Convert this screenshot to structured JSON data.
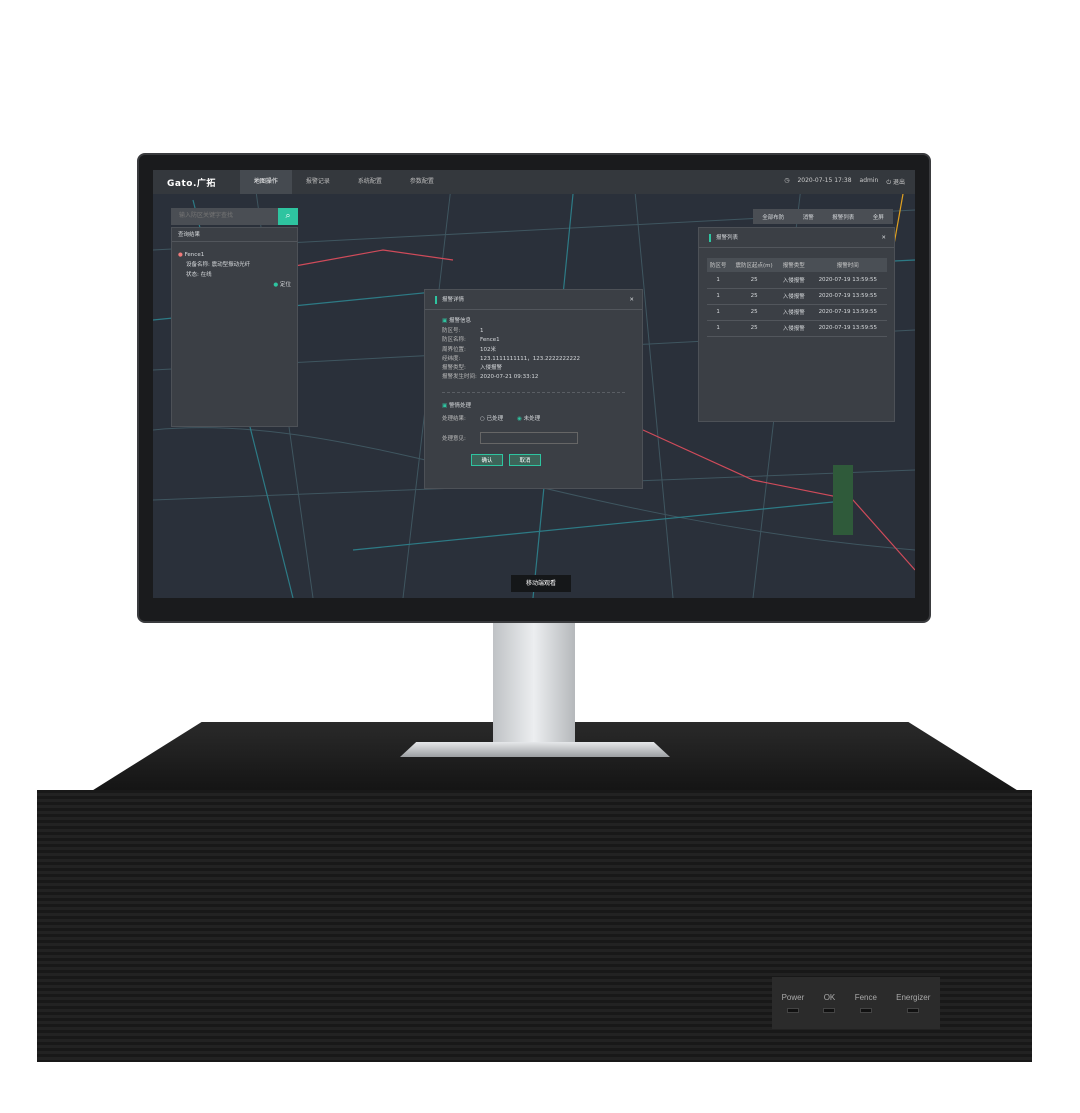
{
  "app": {
    "logo": "Gato.广拓",
    "nav": [
      "地图操作",
      "报警记录",
      "系统配置",
      "参数配置"
    ],
    "datetime": "2020-07-15 17:38",
    "user": "admin",
    "logout": "退出"
  },
  "search": {
    "placeholder": "输入防区关键字查找"
  },
  "results": {
    "title": "查询结果",
    "item": {
      "name": "Fence1",
      "device_label": "设备名称:",
      "device": "震动型振动光纤",
      "status_label": "状态:",
      "status": "在线",
      "locate": "定位"
    }
  },
  "toolbar": [
    "全部布防",
    "消警",
    "报警列表",
    "全屏"
  ],
  "dialog": {
    "title": "报警详情",
    "section1": "报警信息",
    "fields": [
      [
        "防区号:",
        "1"
      ],
      [
        "防区名称:",
        "Fence1"
      ],
      [
        "周界位置:",
        "102米"
      ],
      [
        "经纬度:",
        "123.1111111111，123.2222222222"
      ],
      [
        "报警类型:",
        "入侵报警"
      ],
      [
        "报警发生时间:",
        "2020-07-21  09:33:12"
      ]
    ],
    "section2": "警情处理",
    "result_label": "处理结果:",
    "opt1": "已处理",
    "opt2": "未处理",
    "opinion_label": "处理意见:",
    "confirm": "确认",
    "cancel": "取消"
  },
  "alarm_list": {
    "title": "报警列表",
    "headers": [
      "防区号",
      "震防区起点(m)",
      "报警类型",
      "报警时间"
    ],
    "rows": [
      [
        "1",
        "25",
        "入侵报警",
        "2020-07-19  13:59:55"
      ],
      [
        "1",
        "25",
        "入侵报警",
        "2020-07-19  13:59:55"
      ],
      [
        "1",
        "25",
        "入侵报警",
        "2020-07-19  13:59:55"
      ],
      [
        "1",
        "25",
        "入侵报警",
        "2020-07-19  13:59:55"
      ]
    ]
  },
  "mobile": "移动端观看",
  "leds": [
    "Power",
    "OK",
    "Fence",
    "Energizer"
  ],
  "colors": {
    "accent": "#2ec4a0",
    "map_bg": "#2a303a"
  }
}
